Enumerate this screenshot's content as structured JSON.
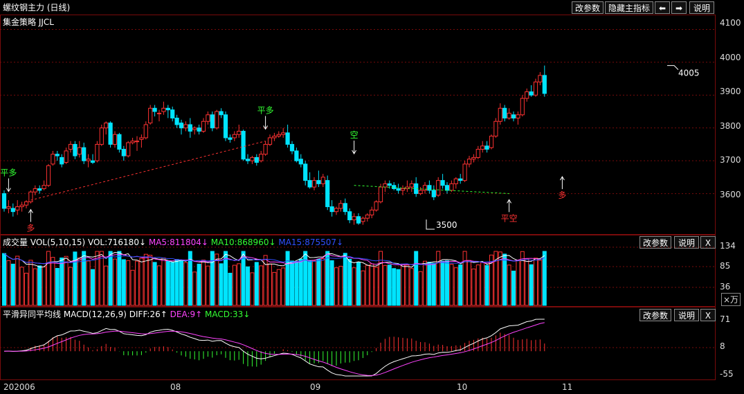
{
  "header": {
    "title": "螺纹钢主力 (日线)",
    "buttons": [
      "改参数",
      "隐藏主指标",
      "⬅",
      "➡",
      "说明"
    ]
  },
  "main": {
    "indicator": "集金策略 JJCL",
    "yticks": [
      "4100",
      "4000",
      "3900",
      "3800",
      "3700",
      "3600"
    ]
  },
  "volume": {
    "label": "成交量",
    "vol": "VOL(5,10,15)",
    "vol_value": "VOL:716180↓",
    "ma5": "MA5:811804↓",
    "ma10": "MA10:868960↓",
    "ma15": "MA15:875507↓",
    "buttons": [
      "改参数",
      "说明",
      "X"
    ],
    "yticks": [
      "134",
      "85",
      "36"
    ],
    "unit": "×万"
  },
  "macd": {
    "label": "平滑异同平均线 MACD(12,26,9)",
    "diff": "DIFF:26↑",
    "dea": "DEA:9↑",
    "macd": "MACD:33↓",
    "buttons": [
      "改参数",
      "说明",
      "X"
    ],
    "yticks": [
      "71",
      "8",
      "-55"
    ]
  },
  "xaxis": [
    "202006",
    "08",
    "09",
    "10",
    "11"
  ],
  "colors": {
    "up": "#ff3232",
    "down": "#00e4ff",
    "ma5": "#ffffff",
    "ma10": "#ff44ff",
    "ma15": "#ffff00",
    "signal_buy": "#ff3232",
    "signal_close": "#33ff33",
    "grid": "#7a0b0b"
  },
  "chart_data": {
    "type": "candlestick",
    "price_range": [
      3500,
      4120
    ],
    "x_labels": [
      "202006",
      "08",
      "09",
      "10",
      "11"
    ],
    "annotations": [
      {
        "text": "平多",
        "index": 1,
        "price": 3600,
        "color": "#33ff33",
        "pos": "above"
      },
      {
        "text": "多",
        "index": 6,
        "price": 3560,
        "color": "#ff3232",
        "pos": "below"
      },
      {
        "text": "平多",
        "index": 59,
        "price": 3790,
        "color": "#33ff33",
        "pos": "above"
      },
      {
        "text": "空",
        "index": 79,
        "price": 3715,
        "color": "#33ff33",
        "pos": "above"
      },
      {
        "text": "平空",
        "index": 114,
        "price": 3590,
        "color": "#ff3232",
        "pos": "below"
      },
      {
        "text": "多",
        "index": 126,
        "price": 3660,
        "color": "#ff3232",
        "pos": "below"
      }
    ],
    "labels": [
      {
        "text": "4005",
        "index": 150,
        "price": 3990
      },
      {
        "text": "3500",
        "index": 95,
        "price": 3500
      }
    ],
    "candles": [
      [
        3600,
        3610,
        3545,
        3555
      ],
      [
        3555,
        3580,
        3540,
        3560
      ],
      [
        3555,
        3570,
        3530,
        3545
      ],
      [
        3550,
        3580,
        3535,
        3560
      ],
      [
        3560,
        3575,
        3545,
        3565
      ],
      [
        3565,
        3580,
        3555,
        3575
      ],
      [
        3575,
        3610,
        3570,
        3605
      ],
      [
        3605,
        3625,
        3595,
        3615
      ],
      [
        3615,
        3625,
        3600,
        3610
      ],
      [
        3615,
        3640,
        3610,
        3625
      ],
      [
        3625,
        3690,
        3620,
        3685
      ],
      [
        3690,
        3730,
        3685,
        3720
      ],
      [
        3720,
        3730,
        3700,
        3715
      ],
      [
        3710,
        3720,
        3680,
        3690
      ],
      [
        3695,
        3740,
        3690,
        3730
      ],
      [
        3735,
        3760,
        3725,
        3750
      ],
      [
        3750,
        3760,
        3705,
        3715
      ],
      [
        3720,
        3760,
        3710,
        3740
      ],
      [
        3740,
        3755,
        3690,
        3700
      ],
      [
        3700,
        3720,
        3680,
        3705
      ],
      [
        3700,
        3720,
        3690,
        3695
      ],
      [
        3700,
        3760,
        3695,
        3750
      ],
      [
        3750,
        3810,
        3745,
        3800
      ],
      [
        3800,
        3820,
        3780,
        3815
      ],
      [
        3815,
        3820,
        3740,
        3750
      ],
      [
        3750,
        3790,
        3740,
        3780
      ],
      [
        3780,
        3785,
        3725,
        3735
      ],
      [
        3735,
        3745,
        3700,
        3715
      ],
      [
        3715,
        3760,
        3710,
        3755
      ],
      [
        3755,
        3770,
        3750,
        3760
      ],
      [
        3760,
        3775,
        3730,
        3760
      ],
      [
        3765,
        3780,
        3740,
        3770
      ],
      [
        3770,
        3820,
        3765,
        3810
      ],
      [
        3815,
        3870,
        3810,
        3860
      ],
      [
        3860,
        3870,
        3835,
        3850
      ],
      [
        3845,
        3855,
        3820,
        3845
      ],
      [
        3850,
        3880,
        3840,
        3860
      ],
      [
        3860,
        3870,
        3830,
        3855
      ],
      [
        3855,
        3865,
        3820,
        3830
      ],
      [
        3830,
        3840,
        3800,
        3810
      ],
      [
        3815,
        3825,
        3780,
        3800
      ],
      [
        3800,
        3820,
        3790,
        3810
      ],
      [
        3810,
        3830,
        3770,
        3790
      ],
      [
        3795,
        3805,
        3780,
        3800
      ],
      [
        3800,
        3810,
        3780,
        3790
      ],
      [
        3790,
        3830,
        3785,
        3820
      ],
      [
        3820,
        3850,
        3810,
        3840
      ],
      [
        3840,
        3850,
        3790,
        3800
      ],
      [
        3800,
        3855,
        3795,
        3850
      ],
      [
        3850,
        3860,
        3830,
        3840
      ],
      [
        3840,
        3850,
        3760,
        3770
      ],
      [
        3770,
        3780,
        3755,
        3765
      ],
      [
        3770,
        3790,
        3760,
        3780
      ],
      [
        3780,
        3810,
        3770,
        3790
      ],
      [
        3790,
        3795,
        3700,
        3705
      ],
      [
        3705,
        3720,
        3690,
        3700
      ],
      [
        3700,
        3715,
        3690,
        3710
      ],
      [
        3710,
        3720,
        3685,
        3695
      ],
      [
        3700,
        3730,
        3695,
        3720
      ],
      [
        3720,
        3760,
        3715,
        3750
      ],
      [
        3750,
        3780,
        3745,
        3770
      ],
      [
        3770,
        3785,
        3760,
        3775
      ],
      [
        3775,
        3790,
        3770,
        3780
      ],
      [
        3780,
        3800,
        3770,
        3785
      ],
      [
        3785,
        3810,
        3740,
        3750
      ],
      [
        3750,
        3760,
        3720,
        3730
      ],
      [
        3730,
        3740,
        3695,
        3700
      ],
      [
        3705,
        3720,
        3680,
        3690
      ],
      [
        3690,
        3700,
        3625,
        3640
      ],
      [
        3640,
        3665,
        3615,
        3620
      ],
      [
        3620,
        3650,
        3610,
        3640
      ],
      [
        3640,
        3670,
        3620,
        3630
      ],
      [
        3630,
        3660,
        3620,
        3650
      ],
      [
        3640,
        3655,
        3550,
        3560
      ],
      [
        3560,
        3580,
        3530,
        3545
      ],
      [
        3545,
        3560,
        3535,
        3555
      ],
      [
        3555,
        3580,
        3545,
        3570
      ],
      [
        3570,
        3585,
        3535,
        3545
      ],
      [
        3545,
        3555,
        3510,
        3520
      ],
      [
        3520,
        3540,
        3505,
        3530
      ],
      [
        3530,
        3540,
        3505,
        3510
      ],
      [
        3515,
        3530,
        3505,
        3525
      ],
      [
        3525,
        3540,
        3515,
        3535
      ],
      [
        3535,
        3560,
        3525,
        3550
      ],
      [
        3550,
        3580,
        3545,
        3575
      ],
      [
        3575,
        3630,
        3570,
        3620
      ],
      [
        3620,
        3640,
        3605,
        3630
      ],
      [
        3630,
        3640,
        3615,
        3625
      ],
      [
        3625,
        3635,
        3610,
        3615
      ],
      [
        3615,
        3630,
        3600,
        3610
      ],
      [
        3610,
        3625,
        3595,
        3615
      ],
      [
        3615,
        3640,
        3605,
        3620
      ],
      [
        3620,
        3640,
        3605,
        3630
      ],
      [
        3630,
        3650,
        3590,
        3600
      ],
      [
        3600,
        3620,
        3595,
        3610
      ],
      [
        3610,
        3635,
        3600,
        3625
      ],
      [
        3625,
        3640,
        3600,
        3610
      ],
      [
        3610,
        3625,
        3580,
        3590
      ],
      [
        3595,
        3650,
        3590,
        3640
      ],
      [
        3640,
        3660,
        3615,
        3625
      ],
      [
        3625,
        3635,
        3600,
        3610
      ],
      [
        3610,
        3640,
        3605,
        3630
      ],
      [
        3630,
        3650,
        3615,
        3645
      ],
      [
        3645,
        3660,
        3630,
        3640
      ],
      [
        3640,
        3700,
        3635,
        3690
      ],
      [
        3690,
        3715,
        3680,
        3705
      ],
      [
        3705,
        3720,
        3695,
        3710
      ],
      [
        3710,
        3745,
        3705,
        3735
      ],
      [
        3735,
        3760,
        3725,
        3745
      ],
      [
        3745,
        3760,
        3725,
        3735
      ],
      [
        3740,
        3780,
        3735,
        3775
      ],
      [
        3775,
        3830,
        3770,
        3820
      ],
      [
        3820,
        3875,
        3810,
        3860
      ],
      [
        3860,
        3870,
        3820,
        3830
      ],
      [
        3830,
        3860,
        3825,
        3845
      ],
      [
        3840,
        3850,
        3820,
        3830
      ],
      [
        3830,
        3850,
        3810,
        3840
      ],
      [
        3840,
        3900,
        3835,
        3890
      ],
      [
        3890,
        3920,
        3880,
        3910
      ],
      [
        3910,
        3930,
        3895,
        3900
      ],
      [
        3900,
        3950,
        3895,
        3940
      ],
      [
        3940,
        3970,
        3930,
        3960
      ],
      [
        3960,
        3990,
        3895,
        3905
      ]
    ]
  }
}
